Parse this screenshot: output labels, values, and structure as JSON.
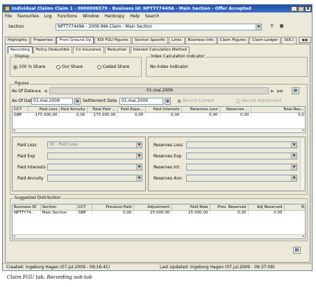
{
  "window": {
    "title": "Individual Claims Claim 1 - 0000006579  - Business Id: NPTTY7449A - Main Section - Offer Accepted",
    "controls": [
      "_",
      "□",
      "X"
    ]
  },
  "menu": [
    "File",
    "Favourites",
    "Log",
    "Functions",
    "Window",
    "Hardcopy",
    "Help",
    "Search"
  ],
  "section": {
    "label": "Section",
    "value": "NPTTY7449A - 2009 IMA Claim - Main Section"
  },
  "top_tabs": [
    "Highlights",
    "Properties",
    "From Ground Up",
    "EDI FGU Figures",
    "Section Specific",
    "Links",
    "Business Info",
    "Claim Figures",
    "Claim Ledger",
    "SOC("
  ],
  "sub_tabs": [
    "Recording",
    "Policy Deductible",
    "Co Insurance",
    "Reduction",
    "Interest Calculation Method"
  ],
  "display": {
    "title": "Display",
    "options": [
      "100 % Share",
      "Our Share",
      "Ceded Share"
    ],
    "selected": "100 % Share"
  },
  "index_calc": {
    "title": "Index Calculation Indicator",
    "value": "No Index Indicator"
  },
  "figures": {
    "title": "Figures",
    "as_of_date_label": "As Of Date",
    "nav_date": "01.mai.2009",
    "as_of_date_field_label": "As Of Date",
    "as_of_date_value": "01.mai.2009",
    "settlement_label": "Settlement Date",
    "settlement_value": "01.mai.2009",
    "record_current": "Record Current",
    "record_adjustment": "Record Adjustment",
    "columns": [
      "CCY",
      "Paid Loss",
      "Paid Annuity",
      "Total Paid ...",
      "Paid Expe...",
      "Paid Interests",
      "Reserves Loss",
      "Reserves ...",
      "Total Res..."
    ],
    "rows": [
      [
        "GBP",
        "175 000,00",
        "0,00",
        "175 000,00",
        "0,00",
        "0,00",
        "0,00",
        "0,00",
        "0,0"
      ]
    ]
  },
  "mapping_left": [
    {
      "label": "Paid Loss",
      "value": "30 - Paid Loss"
    },
    {
      "label": "Paid Exp",
      "value": ""
    },
    {
      "label": "Paid Interests",
      "value": ""
    },
    {
      "label": "Paid Annuity",
      "value": ""
    }
  ],
  "mapping_right": [
    {
      "label": "Reserves Loss",
      "value": ""
    },
    {
      "label": "Reserves Exp",
      "value": ""
    },
    {
      "label": "Reserves Int.",
      "value": ""
    },
    {
      "label": "Reserves Ann.",
      "value": ""
    }
  ],
  "suggested": {
    "title": "Suggested Distribution",
    "columns": [
      "Business ID",
      "Section",
      "CCY",
      "Previous Paid",
      "Adjustment",
      "Paid New",
      "Prev. Reserved",
      "Adj Reserved",
      "R"
    ],
    "rows": [
      [
        "NPTTY74...",
        "Main Section",
        "GBP",
        "0,00",
        "25 000,00",
        "25 000,00",
        "0,00",
        "0,00",
        ""
      ]
    ]
  },
  "status": {
    "created": "Created: Ingeborg Hagen (07.jul.2009 - 09:16:41)",
    "updated": "Last Updated: Ingeborg Hagen (07.jul.2009 - 09:37:09)"
  },
  "caption": "Claim FGU tab, Recording sub-tab"
}
